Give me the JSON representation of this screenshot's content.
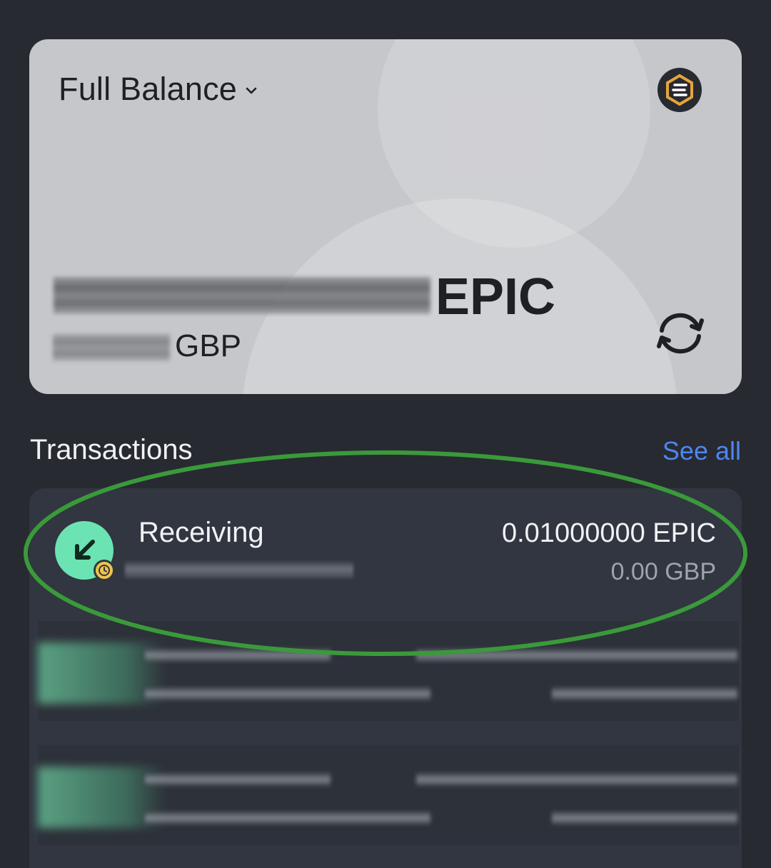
{
  "balance_card": {
    "title": "Full Balance",
    "crypto_unit": "EPIC",
    "fiat_unit": "GBP",
    "colors": {
      "card": "#c6c7cb",
      "logo_accent": "#e6a43a"
    },
    "icons": [
      "chevron-down-icon",
      "epic-coin-logo",
      "refresh-icon"
    ]
  },
  "transactions": {
    "header": "Transactions",
    "see_all": "See all",
    "items": [
      {
        "type": "Receiving",
        "amount": "0.01000000 EPIC",
        "fiat": "0.00 GBP",
        "status_icon": "pending-clock-icon",
        "direction_icon": "arrow-down-left-icon",
        "icon_color": "#6ce3b2"
      }
    ]
  },
  "annotation": {
    "type": "ellipse",
    "color": "#3a9a3a"
  },
  "colors": {
    "background": "#272a31",
    "panel": "#313640",
    "link": "#4f86f0"
  }
}
